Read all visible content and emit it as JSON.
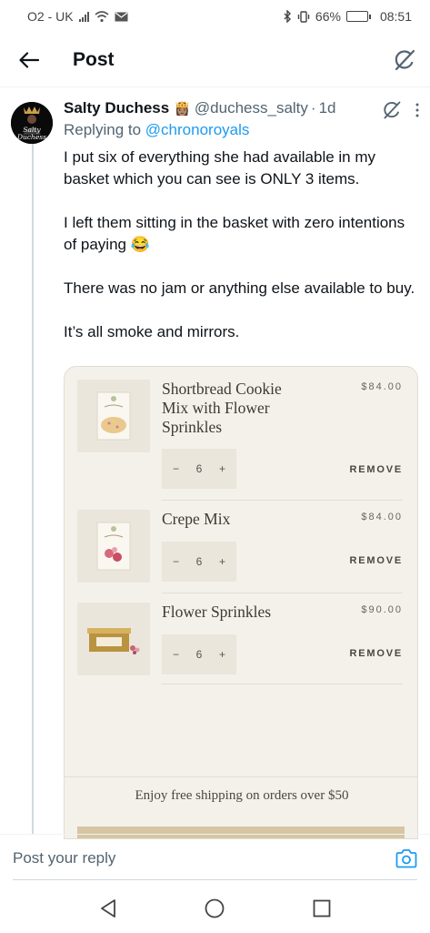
{
  "status_bar": {
    "carrier": "O2 - UK",
    "battery": "66%",
    "battery_level": 0.66,
    "time": "08:51",
    "icons": [
      "signal-icon",
      "wifi-icon",
      "mail-icon",
      "bluetooth-icon",
      "vibrate-icon",
      "battery-icon"
    ]
  },
  "header": {
    "title": "Post",
    "back_icon": "back-arrow-icon",
    "grok_icon": "grok-icon"
  },
  "tweet": {
    "author_name": "Salty Duchess",
    "author_emoji": "👸🏽",
    "handle": "@duchess_salty",
    "separator": "·",
    "time": "1d",
    "replying_prefix": "Replying to",
    "replying_handle": "@chronoroyals",
    "avatar_text": [
      "Salty",
      "Duchess"
    ],
    "paragraphs": [
      "I put six of everything she had available in my basket which you can see is ONLY 3 items.",
      "I left them sitting in the basket with zero intentions of paying 😂",
      "There was no jam or anything else available to buy.",
      "It’s all smoke and mirrors."
    ]
  },
  "cart": {
    "items": [
      {
        "name": "Shortbread Cookie Mix with Flower Sprinkles",
        "price": "$84.00",
        "quantity": "6",
        "minus": "−",
        "plus": "+",
        "remove_label": "REMOVE"
      },
      {
        "name": "Crepe Mix",
        "price": "$84.00",
        "quantity": "6",
        "minus": "−",
        "plus": "+",
        "remove_label": "REMOVE"
      },
      {
        "name": "Flower Sprinkles",
        "price": "$90.00",
        "quantity": "6",
        "minus": "−",
        "plus": "+",
        "remove_label": "REMOVE"
      }
    ],
    "shipping_note": "Enjoy free shipping on orders over $50"
  },
  "reply": {
    "placeholder": "Post your reply",
    "camera_icon": "camera-icon"
  },
  "nav": {
    "icons": [
      "nav-back-icon",
      "nav-home-icon",
      "nav-recents-icon"
    ]
  },
  "colors": {
    "accent": "#1d9bf0",
    "text": "#0f1419",
    "muted": "#536471",
    "card_bg": "#f4f1ea",
    "checkout": "#d7c5a3"
  }
}
